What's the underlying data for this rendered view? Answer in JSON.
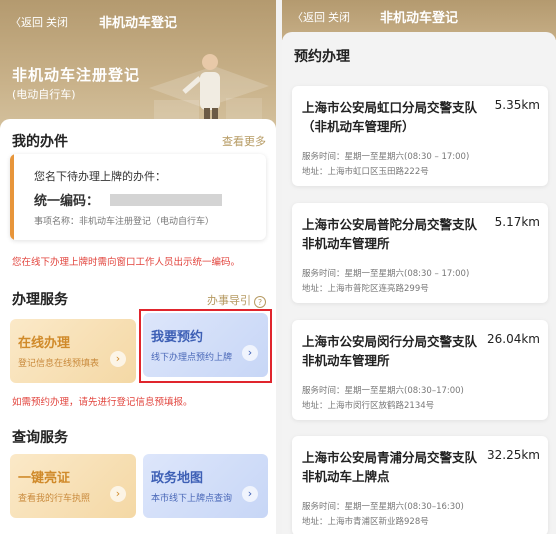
{
  "left": {
    "nav": {
      "back": "〈返回",
      "close": "关闭",
      "title": "非机动车登记"
    },
    "hero": {
      "title": "非机动车注册登记",
      "subtitle": "(电动自行车)"
    },
    "my_items": {
      "title": "我的办件",
      "more": "查看更多",
      "pending_text": "您名下待办理上牌的办件：",
      "code_label": "统一编码：",
      "item_name": "事项名称：非机动车注册登记（电动自行车）"
    },
    "notice": "您在线下办理上牌时需向窗口工作人员出示统一编码。",
    "services": {
      "title": "办理服务",
      "guide": "办事导引",
      "guide_icon": "?",
      "online": {
        "title": "在线办理",
        "sub": "登记信息在线预填表"
      },
      "appointment": {
        "title": "我要预约",
        "sub": "线下办理点预约上牌"
      },
      "arrow": "›"
    },
    "appoint_note": "如需预约办理，请先进行登记信息预填报。",
    "query": {
      "title": "查询服务",
      "license": {
        "title": "一键亮证",
        "sub": "查看我的行车执照"
      },
      "map": {
        "title": "政务地图",
        "sub": "本市线下上牌点查询"
      }
    },
    "colors": {
      "accent_gold": "#b69a62",
      "highlight_red": "#e0252d",
      "notice_red": "#e2443d"
    }
  },
  "right": {
    "nav": {
      "back": "〈返回",
      "close": "关闭",
      "title": "非机动车登记"
    },
    "heading": "预约办理",
    "offices": [
      {
        "name": "上海市公安局虹口分局交警支队（非机动车管理所）",
        "distance": "5.35km",
        "hours": "服务时间：星期一至星期六(08:30 – 17:00)",
        "address": "地址：上海市虹口区玉田路222号"
      },
      {
        "name": "上海市公安局普陀分局交警支队非机动车管理所",
        "distance": "5.17km",
        "hours": "服务时间：星期一至星期六(08:30 – 17:00)",
        "address": "地址：上海市普陀区连亮路299号"
      },
      {
        "name": "上海市公安局闵行分局交警支队非机动车管理所",
        "distance": "26.04km",
        "hours": "服务时间：星期一至星期六(08:30–17:00)",
        "address": "地址：上海市闵行区放鹤路2134号"
      },
      {
        "name": "上海市公安局青浦分局交警支队非机动车上牌点",
        "distance": "32.25km",
        "hours": "服务时间：星期一至星期六(08:30–16:30)",
        "address": "地址：上海市青浦区新业路928号"
      }
    ]
  }
}
